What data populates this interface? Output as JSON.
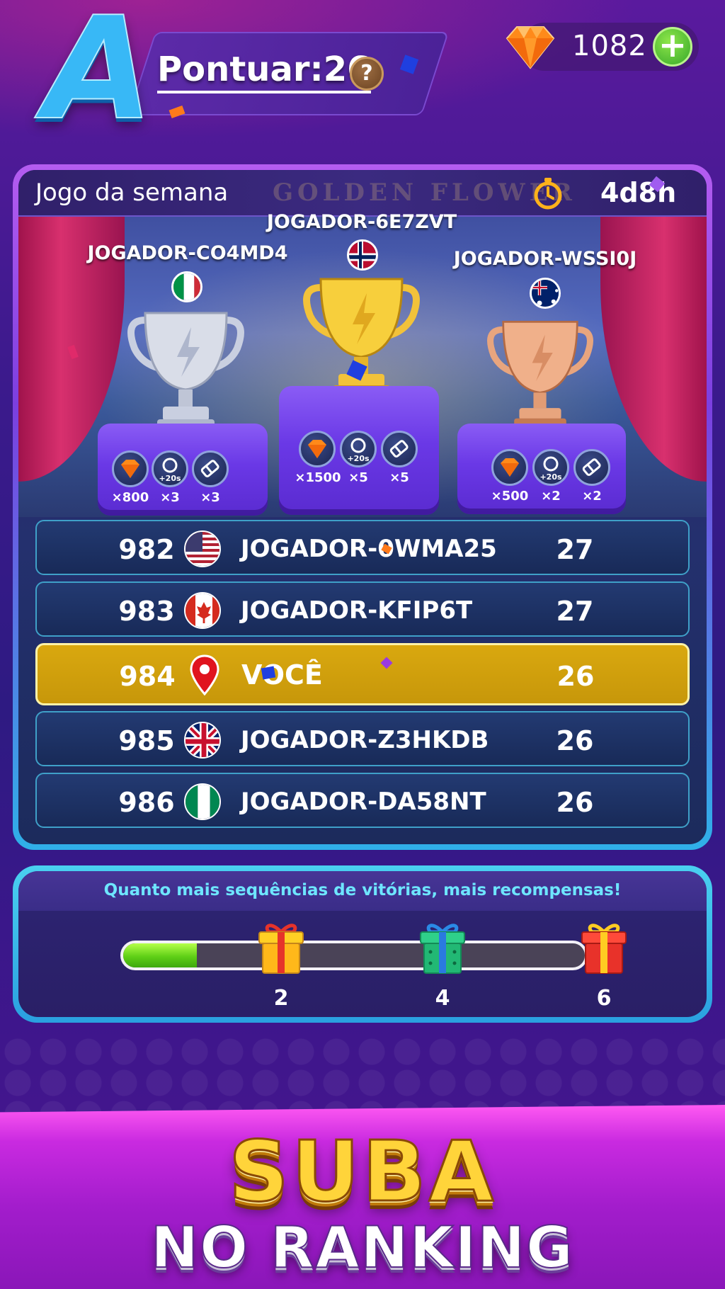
{
  "header": {
    "level_letter": "A",
    "score_label": "Pontuar:26",
    "help_icon": "question-icon",
    "gems": "1082",
    "gem_icon": "gem-icon",
    "add_icon": "plus-icon"
  },
  "leaderboard": {
    "title": "Jogo da semana",
    "event_watermark": "GOLDEN FLOWER",
    "timer_icon": "stopwatch-icon",
    "time_left": "4d8h",
    "podium": [
      {
        "place": "second",
        "name": "JOGADOR-CO4MD4",
        "flag": "italy",
        "trophy": "silver-trophy-icon",
        "rewards": [
          "×800",
          "×3",
          "×3"
        ]
      },
      {
        "place": "first",
        "name": "JOGADOR-6E7ZVT",
        "flag": "norway",
        "trophy": "gold-trophy-icon",
        "rewards": [
          "×1500",
          "×5",
          "×5"
        ]
      },
      {
        "place": "third",
        "name": "JOGADOR-WSSI0J",
        "flag": "australia",
        "trophy": "bronze-trophy-icon",
        "rewards": [
          "×500",
          "×2",
          "×2"
        ]
      }
    ],
    "reward_icons": [
      "gem-icon",
      "timer-plus-20s-icon",
      "eraser-icon"
    ],
    "timer_bonus_label": "+20s",
    "rows": [
      {
        "rank": "982",
        "flag": "usa",
        "name": "JOGADOR-0WMA25",
        "score": "27",
        "is_me": false
      },
      {
        "rank": "983",
        "flag": "canada",
        "name": "JOGADOR-KFIP6T",
        "score": "27",
        "is_me": false
      },
      {
        "rank": "984",
        "flag": "location-pin",
        "name": "VOCÊ",
        "score": "26",
        "is_me": true
      },
      {
        "rank": "985",
        "flag": "uk",
        "name": "JOGADOR-Z3HKDB",
        "score": "26",
        "is_me": false
      },
      {
        "rank": "986",
        "flag": "nigeria",
        "name": "JOGADOR-DA58NT",
        "score": "26",
        "is_me": false
      }
    ]
  },
  "streak": {
    "message": "Quanto mais sequências de vitórias, mais recompensas!",
    "progress_fraction": 0.16,
    "milestones": [
      {
        "label": "2",
        "gift": "gift-yellow-icon"
      },
      {
        "label": "4",
        "gift": "gift-green-icon"
      },
      {
        "label": "6",
        "gift": "gift-red-icon"
      }
    ]
  },
  "banner": {
    "line1": "SUBA",
    "line2": "NO RANKING"
  },
  "colors": {
    "accent_gold": "#d9a80f",
    "accent_cyan": "#6ee6ff",
    "bar_green": "#5fcf16",
    "panel_blue": "#1c2b5c"
  }
}
